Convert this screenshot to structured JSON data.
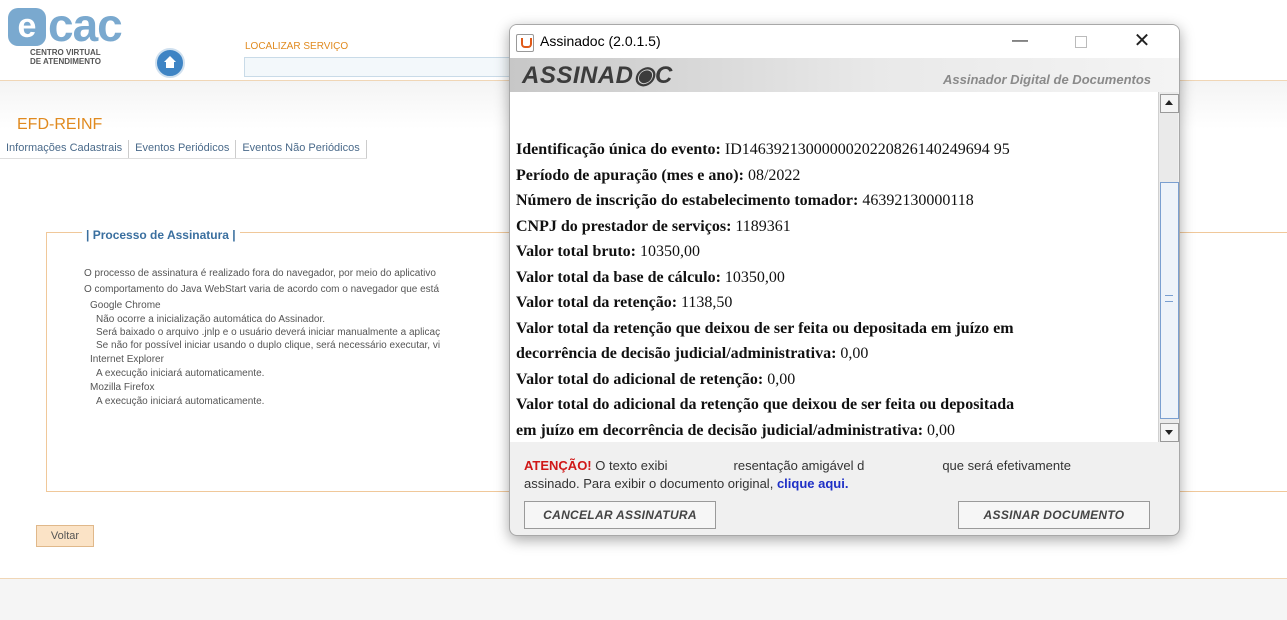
{
  "header": {
    "logo_text": "cac",
    "logo_letter": "e",
    "logo_subtitle_1": "CENTRO VIRTUAL",
    "logo_subtitle_2": "DE ATENDIMENTO",
    "locate_label": "LOCALIZAR SERVIÇO",
    "locate_value": ""
  },
  "page": {
    "section_title": "EFD-REINF",
    "menu": [
      "Informações Cadastrais",
      "Eventos Periódicos",
      "Eventos Não Periódicos"
    ],
    "panel_title": "| Processo de Assinatura |",
    "lines": {
      "p1": "O processo de assinatura é realizado fora do navegador, por meio do aplicativo",
      "p2": "O comportamento do Java WebStart varia de acordo com o navegador que está",
      "chrome": "Google Chrome",
      "chrome_1": "Não ocorre a inicialização automática do Assinador.",
      "chrome_2": "Será baixado o arquivo .jnlp e o usuário deverá iniciar manualmente a aplicaç",
      "chrome_3": "Se não for possível iniciar usando o duplo clique, será necessário executar, vi",
      "ie": "Internet Explorer",
      "ie_1": "A execução iniciará automaticamente.",
      "firefox": "Mozilla Firefox",
      "firefox_1": "A execução iniciará automaticamente."
    },
    "back_button": "Voltar"
  },
  "dialog": {
    "title": "Assinadoc (2.0.1.5)",
    "minimize": "—",
    "close": "✕",
    "banner_logo": "ASSINAD◉C",
    "banner_subtitle": "Assinador Digital de Documentos",
    "doc_lines": [
      {
        "label": "Identificação única do evento: ",
        "value": "ID1463921300000020220826140249694 95"
      },
      {
        "label": "Período de apuração (mes e ano): ",
        "value": "08/2022"
      },
      {
        "label": "Número de inscrição do estabelecimento tomador: ",
        "value": "46392130000118"
      },
      {
        "label": "CNPJ do prestador de serviços: ",
        "value": "1189361"
      },
      {
        "label": "Valor total bruto: ",
        "value": "10350,00"
      },
      {
        "label": "Valor total da base de cálculo: ",
        "value": "10350,00"
      },
      {
        "label": "Valor total da retenção: ",
        "value": "1138,50"
      },
      {
        "label": "Valor total da retenção que deixou de ser feita ou depositada em juízo em",
        "value": ""
      },
      {
        "label": "decorrência de decisão judicial/administrativa: ",
        "value": "0,00"
      },
      {
        "label": "Valor total do adicional de retenção: ",
        "value": "0,00"
      },
      {
        "label": "Valor total do adicional da retenção que deixou de ser feita ou depositada",
        "value": ""
      },
      {
        "label": "em juízo em decorrência de decisão judicial/administrativa: ",
        "value": "0,00"
      }
    ],
    "warning_label": "ATENÇÃO!",
    "warning_text_1": " O texto exibi",
    "warning_text_2": "resentação amigável d",
    "warning_text_3": "que será efetivamente",
    "warning_text_4": "assinado. Para exibir o documento original, ",
    "warning_link": "clique aqui.",
    "cancel_button": "CANCELAR ASSINATURA",
    "sign_button": "ASSINAR DOCUMENTO"
  }
}
